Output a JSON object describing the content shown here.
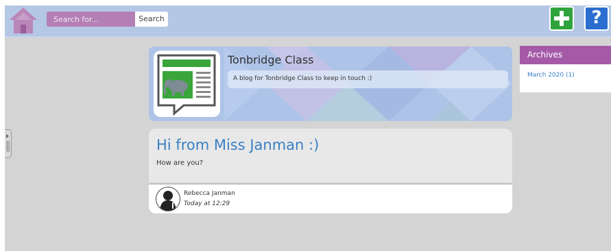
{
  "header": {
    "search": {
      "placeholder": "Search for...",
      "value": "",
      "button_label": "Search"
    },
    "add_icon": "plus-icon",
    "help_icon_glyph": "?"
  },
  "blog": {
    "title": "Tonbridge Class",
    "description": "A blog for Tonbridge Class to keep in touch :)"
  },
  "post": {
    "title": "Hi from Miss Janman :)",
    "body": "How are you?",
    "author": "Rebecca Janman",
    "time": "Today at 12:29"
  },
  "archives": {
    "title": "Archives",
    "items": [
      {
        "label": "March 2020 (1)"
      }
    ]
  },
  "colors": {
    "header_bg": "#b4c7e5",
    "search_bg": "#b37fb5",
    "add_button": "#2fa43c",
    "help_button": "#2a6fd0",
    "archives_header": "#a55aa8",
    "link": "#3a7fc4",
    "page_bg": "#d4d4d4"
  }
}
